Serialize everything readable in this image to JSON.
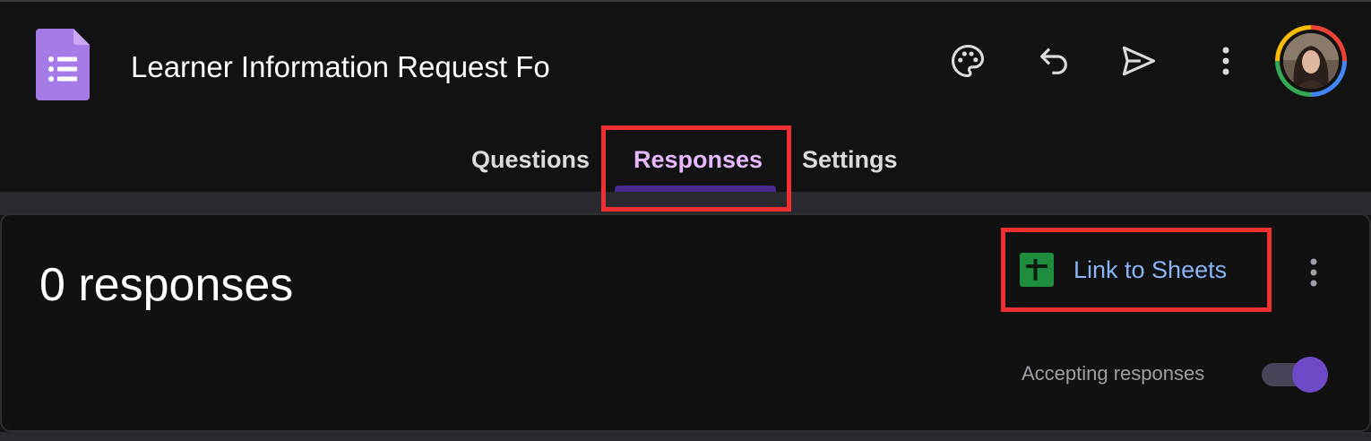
{
  "app": {
    "form_title": "Learner Information Request Fo"
  },
  "header_icons": {
    "palette": "palette-icon",
    "undo": "undo-icon",
    "send": "send-icon",
    "more": "more-vert-icon"
  },
  "tabs": [
    {
      "label": "Questions",
      "active": false
    },
    {
      "label": "Responses",
      "active": true
    },
    {
      "label": "Settings",
      "active": false
    }
  ],
  "responses_card": {
    "count_text": "0 responses",
    "link_to_sheets_label": "Link to Sheets",
    "accepting_label": "Accepting responses",
    "accepting_on": true
  },
  "colors": {
    "background": "#121212",
    "active_tab": "#e7b7ff",
    "link_blue": "#8ab4f8",
    "toggle_on": "#6f4ac8",
    "highlight": "#f03030",
    "forms_purple": "#a67be8",
    "sheets_green": "#1e8e3e"
  }
}
